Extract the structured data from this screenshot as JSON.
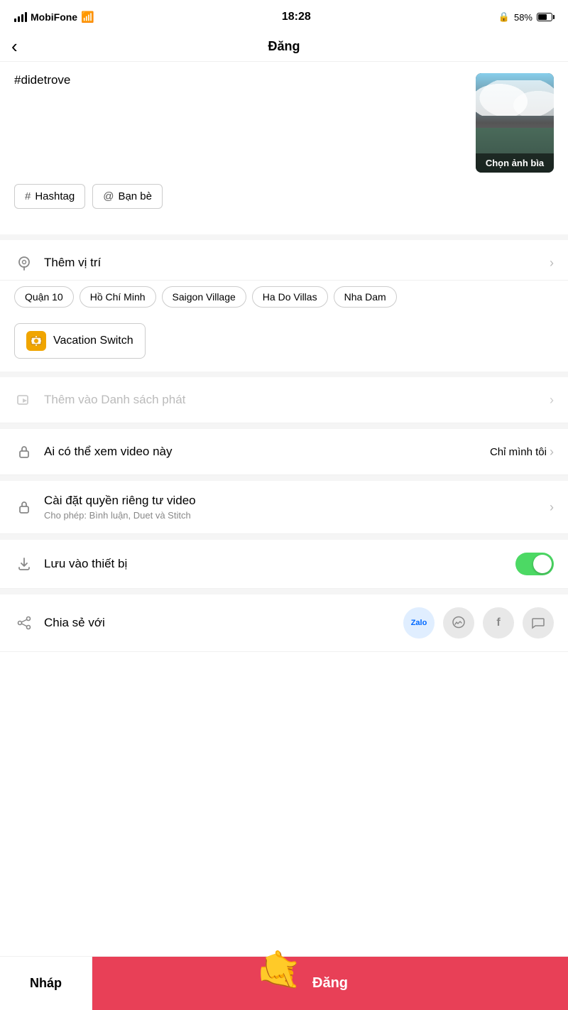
{
  "statusBar": {
    "carrier": "MobiFone",
    "time": "18:28",
    "battery": "58%",
    "wifi": true
  },
  "nav": {
    "backLabel": "‹",
    "title": "Đăng"
  },
  "caption": {
    "text": "#didetrove",
    "coverLabel": "Chọn ảnh bìa"
  },
  "tagButtons": [
    {
      "icon": "#",
      "label": "Hashtag"
    },
    {
      "icon": "@",
      "label": "Bạn bè"
    }
  ],
  "locationRow": {
    "icon": "📍",
    "title": "Thêm vị trí"
  },
  "locationChips": [
    "Quận 10",
    "Hồ Chí Minh",
    "Saigon Village",
    "Ha Do Villas",
    "Nha Dam"
  ],
  "vacationSwitch": {
    "label": "Vacation Switch"
  },
  "playlistRow": {
    "title": "Thêm vào Danh sách phát",
    "disabled": true
  },
  "privacyRow": {
    "title": "Ai có thể xem video này",
    "value": "Chỉ mình tôi"
  },
  "privacySettingsRow": {
    "title": "Cài đặt quyền riêng tư video",
    "subtitle": "Cho phép: Bình luận, Duet và Stitch"
  },
  "saveDeviceRow": {
    "title": "Lưu vào thiết bị",
    "toggleOn": true
  },
  "shareRow": {
    "title": "Chia sẻ với",
    "platforms": [
      "Zalo",
      "💬",
      "f",
      "💬2"
    ]
  },
  "bottomBar": {
    "draftLabel": "Nháp",
    "postLabel": "Đăng"
  }
}
